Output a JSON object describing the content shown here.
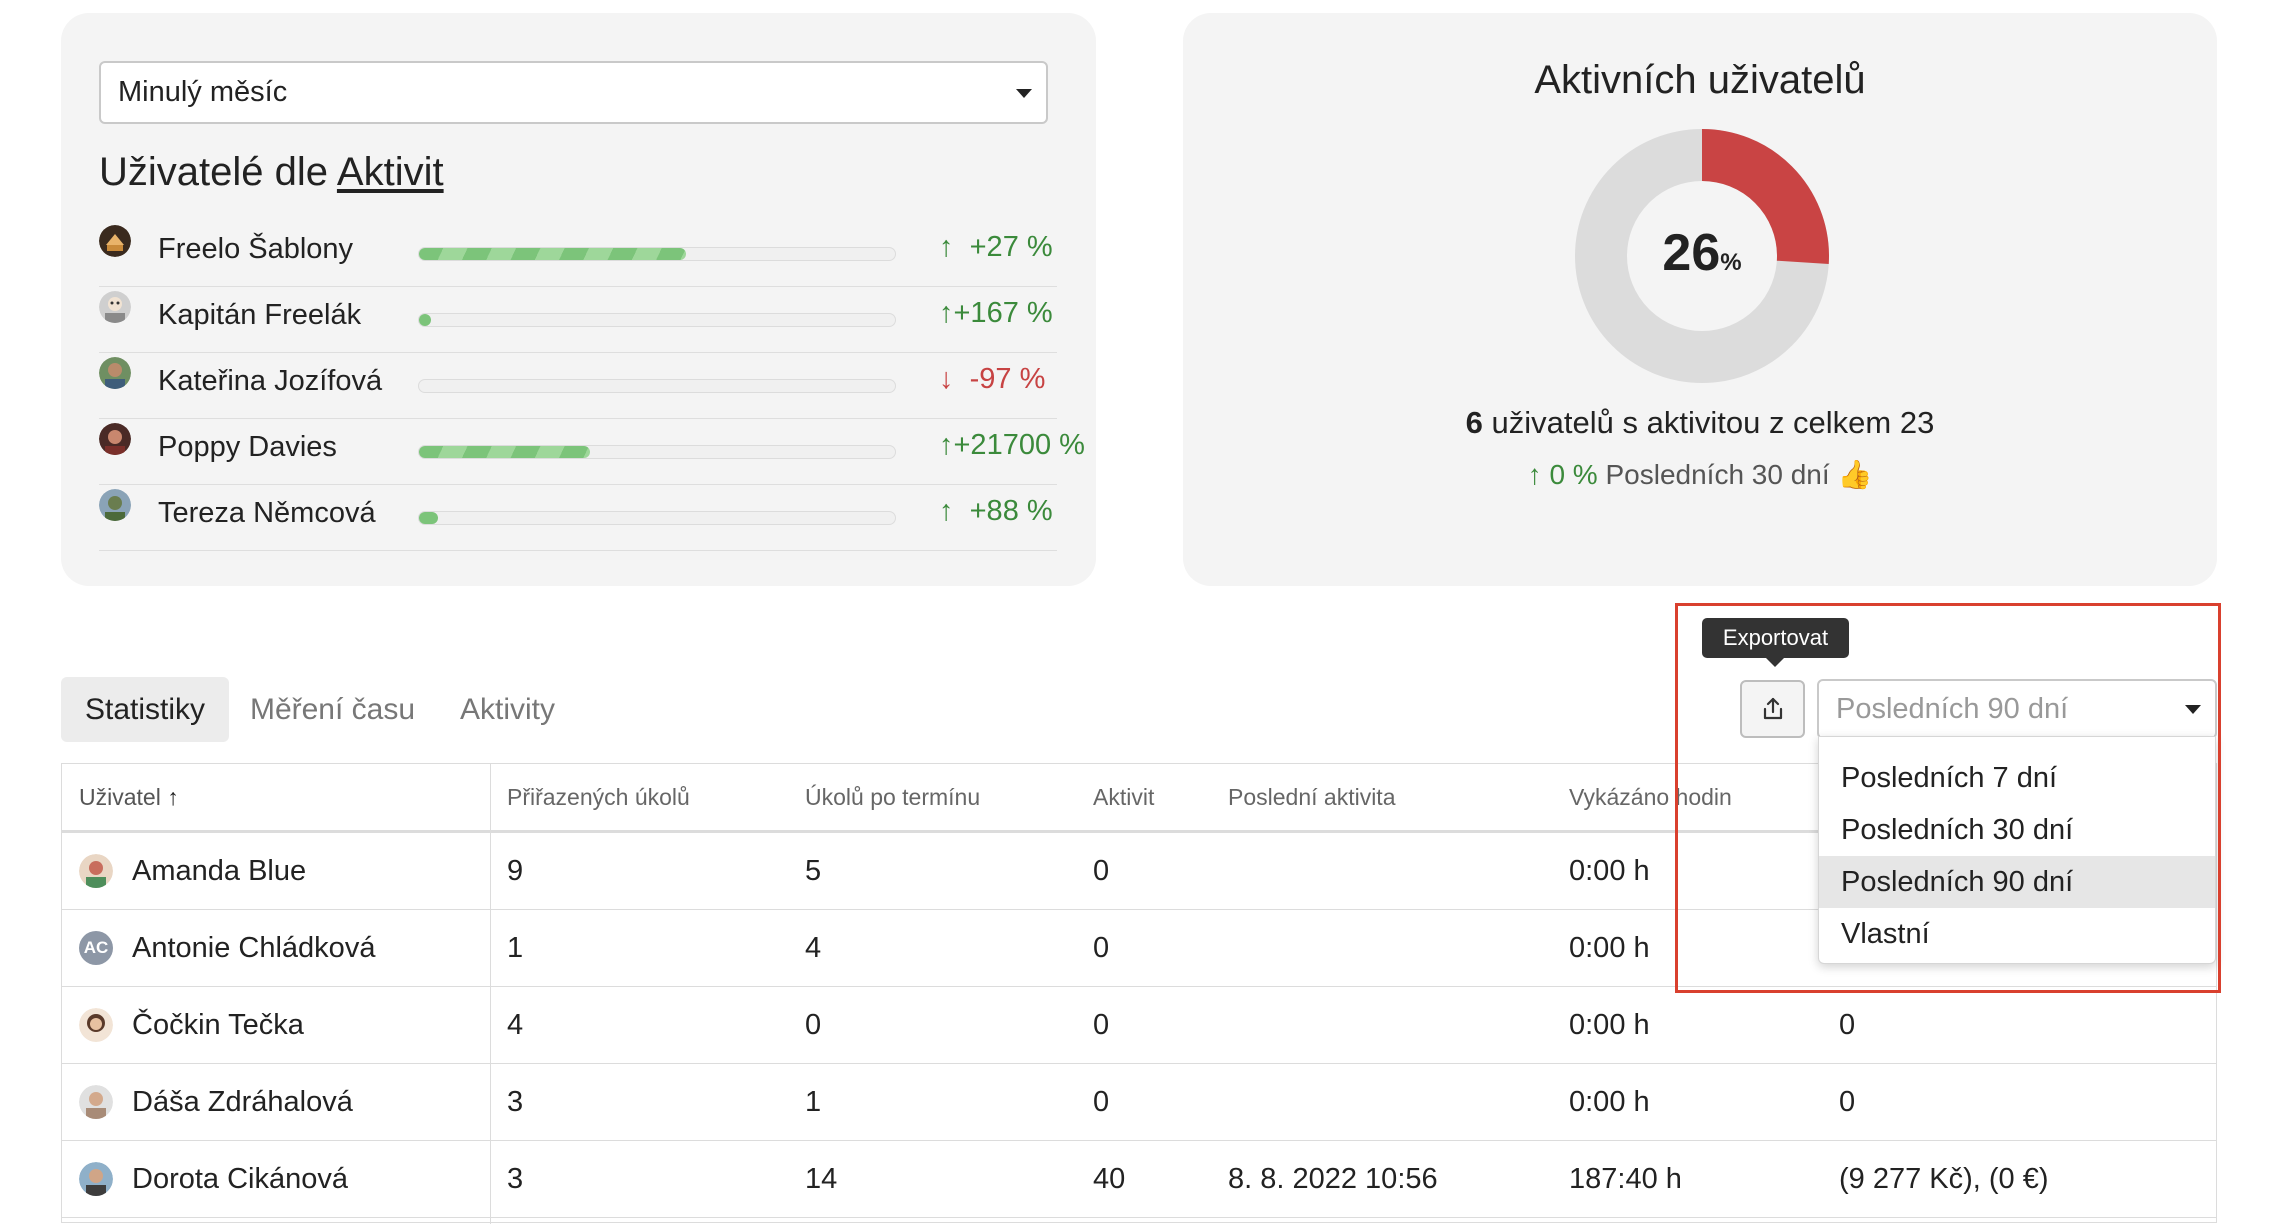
{
  "filter": {
    "period_value": "Minulý měsíc"
  },
  "users_by_activity": {
    "title_prefix": "Uživatelé dle",
    "title_link": "Aktivit",
    "rows": [
      {
        "name": "Freelo Šablony",
        "fill": 0.56,
        "trend": "+27 %",
        "direction": "up"
      },
      {
        "name": "Kapitán Freelák",
        "fill": 0.02,
        "trend": "+167 %",
        "direction": "up"
      },
      {
        "name": "Kateřina Jozífová",
        "fill": 0.0,
        "trend": "-97 %",
        "direction": "down"
      },
      {
        "name": "Poppy Davies",
        "fill": 0.36,
        "trend": "+21700 %",
        "direction": "up"
      },
      {
        "name": "Tereza Němcová",
        "fill": 0.04,
        "trend": "+88 %",
        "direction": "up"
      }
    ]
  },
  "active_users": {
    "title": "Aktivních uživatelů",
    "percent": "26",
    "percent_sign": "%",
    "percent_value": 26,
    "count": "6",
    "summary_text": "uživatelů s aktivitou z celkem 23",
    "trend_value": "0 %",
    "trend_label": "Posledních 30 dní",
    "colors": {
      "active": "#c94444",
      "inactive": "#dcdcdc"
    }
  },
  "tabs": [
    {
      "label": "Statistiky",
      "active": true
    },
    {
      "label": "Měření času",
      "active": false
    },
    {
      "label": "Aktivity",
      "active": false
    }
  ],
  "export": {
    "tooltip": "Exportovat",
    "icon": "upload-icon"
  },
  "range": {
    "placeholder": "Posledních 90 dní",
    "options": [
      "Posledních 7 dní",
      "Posledních 30 dní",
      "Posledních 90 dní",
      "Vlastní"
    ],
    "selected": "Posledních 90 dní"
  },
  "table": {
    "columns": [
      "Uživatel",
      "Přiřazených úkolů",
      "Úkolů po termínu",
      "Aktivit",
      "Poslední aktivita",
      "Vykázáno hodin"
    ],
    "sort_indicator": "↑",
    "rows": [
      {
        "name": "Amanda Blue",
        "assigned": "9",
        "overdue": "5",
        "activities": "0",
        "last": "",
        "hours": "0:00 h",
        "extra": ""
      },
      {
        "name": "Antonie Chládková",
        "initials": "AC",
        "assigned": "1",
        "overdue": "4",
        "activities": "0",
        "last": "",
        "hours": "0:00 h",
        "extra": ""
      },
      {
        "name": "Čočkin Tečka",
        "assigned": "4",
        "overdue": "0",
        "activities": "0",
        "last": "",
        "hours": "0:00 h",
        "extra": "0"
      },
      {
        "name": "Dáša Zdráhalová",
        "assigned": "3",
        "overdue": "1",
        "activities": "0",
        "last": "",
        "hours": "0:00 h",
        "extra": "0"
      },
      {
        "name": "Dorota Cikánová",
        "assigned": "3",
        "overdue": "14",
        "activities": "40",
        "last": "8. 8. 2022 10:56",
        "hours": "187:40 h",
        "extra": "(9 277 Kč), (0 €)"
      }
    ]
  }
}
